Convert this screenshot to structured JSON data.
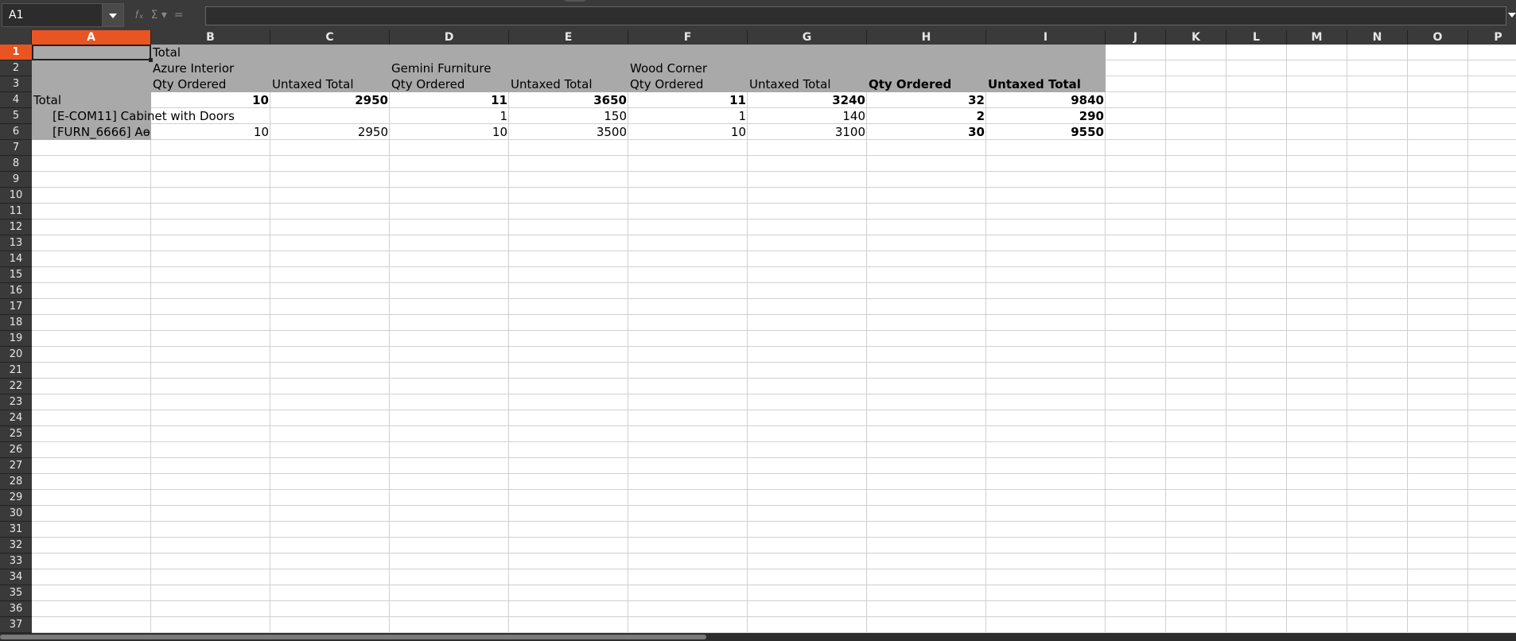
{
  "formula_bar": {
    "name_box": "A1",
    "formula": "",
    "icons": [
      "function-wizard-icon",
      "sum-icon",
      "equals-icon"
    ]
  },
  "columns": [
    "A",
    "B",
    "C",
    "D",
    "E",
    "F",
    "G",
    "H",
    "I",
    "J",
    "K",
    "L",
    "M",
    "N",
    "O",
    "P"
  ],
  "rows": [
    "1",
    "2",
    "3",
    "4",
    "5",
    "6",
    "7",
    "8",
    "9",
    "10",
    "11",
    "12",
    "13",
    "14",
    "15",
    "16",
    "17",
    "18",
    "19",
    "20",
    "21",
    "22",
    "23",
    "24",
    "25",
    "26",
    "27",
    "28",
    "29",
    "30",
    "31",
    "32",
    "33",
    "34",
    "35",
    "36",
    "37"
  ],
  "active_cell": {
    "column": "A",
    "row": "1"
  },
  "colors": {
    "header_bg": "#3a3a3a",
    "active_header": "#e95420",
    "pivot_header_bg": "#a9a9a9"
  },
  "sheet": {
    "r1": {
      "b": "Total"
    },
    "r2": {
      "b": "Azure Interior",
      "d": "Gemini Furniture",
      "f": "Wood Corner"
    },
    "r3": {
      "b": "Qty Ordered",
      "c": "Untaxed Total",
      "d": "Qty Ordered",
      "e": "Untaxed Total",
      "f": "Qty Ordered",
      "g": "Untaxed Total",
      "h": "Qty Ordered",
      "i": "Untaxed Total"
    },
    "r4": {
      "a": "Total",
      "b": "10",
      "c": "2950",
      "d": "11",
      "e": "3650",
      "f": "11",
      "g": "3240",
      "h": "32",
      "i": "9840"
    },
    "r5": {
      "a": "[E-COM11] Cabinet with Doors",
      "d": "1",
      "e": "150",
      "f": "1",
      "g": "140",
      "h": "2",
      "i": "290"
    },
    "r6": {
      "a": "[FURN_6666] Aɵ",
      "b": "10",
      "c": "2950",
      "d": "10",
      "e": "3500",
      "f": "10",
      "g": "3100",
      "h": "30",
      "i": "9550"
    }
  }
}
